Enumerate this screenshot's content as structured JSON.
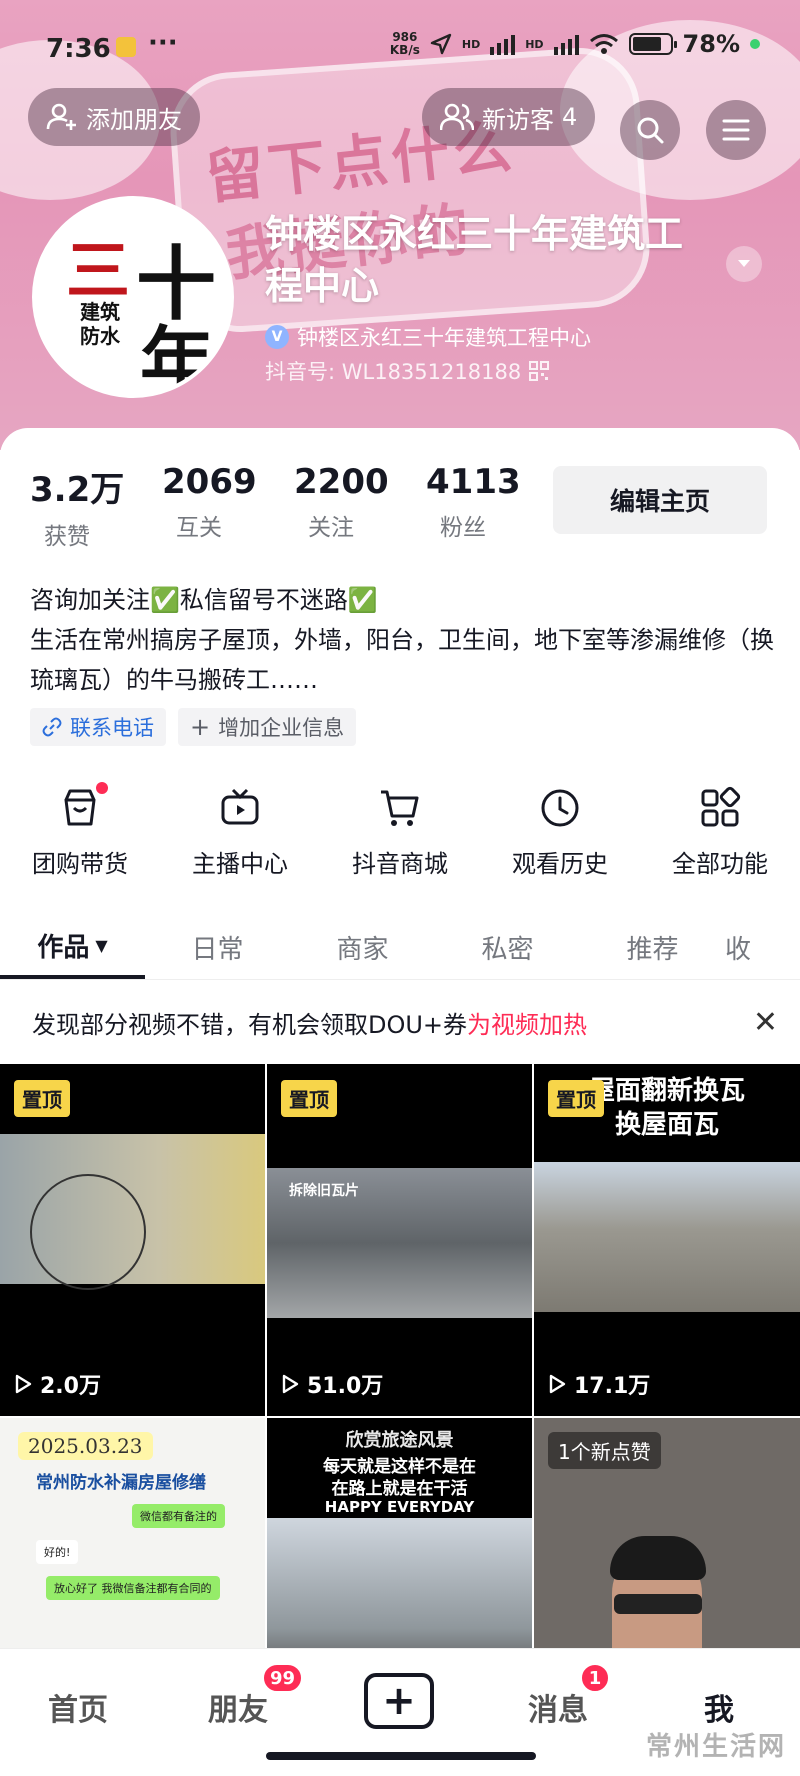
{
  "status_bar": {
    "time": "7:36",
    "dots": "···",
    "speed_top": "986",
    "speed_unit": "KB/s",
    "hd1": "HD",
    "hd2": "HD",
    "battery_percent": 78,
    "battery_label": "78%"
  },
  "banner": {
    "sticker_line1": "留下点什么",
    "sticker_line2": "我挺你的"
  },
  "header": {
    "add_friend": "添加朋友",
    "new_visitors": "新访客",
    "new_visitors_count": "4"
  },
  "profile": {
    "avatar_text_big": "三十年",
    "avatar_text_small1": "建筑",
    "avatar_text_small2": "防水",
    "name": "钟楼区永红三十年建筑工程中心",
    "verified_name": "钟楼区永红三十年建筑工程中心",
    "douyin_id": "抖音号: WL18351218188"
  },
  "stats": [
    {
      "value": "3.2万",
      "label": "获赞"
    },
    {
      "value": "2069",
      "label": "互关"
    },
    {
      "value": "2200",
      "label": "关注"
    },
    {
      "value": "4113",
      "label": "粉丝"
    }
  ],
  "edit_button": "编辑主页",
  "bio": {
    "line1": "咨询加关注✅私信留号不迷路✅",
    "line2": "生活在常州搞房子屋顶，外墙，阳台，卫生间，地下室等渗漏维修（换琉璃瓦）的牛马搬砖工……"
  },
  "tags": {
    "phone": "联系电话",
    "add_info": "增加企业信息"
  },
  "features": [
    {
      "label": "团购带货",
      "icon": "shop-bag-icon",
      "dot": true
    },
    {
      "label": "主播中心",
      "icon": "tv-icon",
      "dot": false
    },
    {
      "label": "抖音商城",
      "icon": "cart-icon",
      "dot": false
    },
    {
      "label": "观看历史",
      "icon": "clock-icon",
      "dot": false
    },
    {
      "label": "全部功能",
      "icon": "grid-apps-icon",
      "dot": false
    }
  ],
  "tabs": [
    "作品",
    "日常",
    "商家",
    "私密",
    "推荐",
    "收"
  ],
  "promo": {
    "text": "发现部分视频不错，有机会领取DOU+券",
    "highlight": "为视频加热"
  },
  "videos": [
    {
      "pinned": "置顶",
      "views": "2.0万"
    },
    {
      "pinned": "置顶",
      "views": "51.0万",
      "caption": "拆除旧瓦片"
    },
    {
      "pinned": "置顶",
      "views": "17.1万",
      "title1": "屋面翻新换瓦",
      "title2": "换屋面瓦"
    },
    {
      "date": "2025.03.23",
      "title": "常州防水补漏房屋修缮",
      "chat1": "微信都有备注的",
      "chat2": "好的!",
      "chat3": "放心好了 我微信备注都有合同的"
    },
    {
      "title1": "欣赏旅途风景",
      "title2": "每天就是这样不是在",
      "title3": "在路上就是在干活",
      "title4": "HAPPY EVERYDAY"
    },
    {
      "new_likes": "1个新点赞"
    }
  ],
  "bottom_nav": {
    "home": "首页",
    "friends": "朋友",
    "friends_badge": "99",
    "messages": "消息",
    "messages_badge": "1",
    "me": "我"
  },
  "watermark": "常州生活网"
}
